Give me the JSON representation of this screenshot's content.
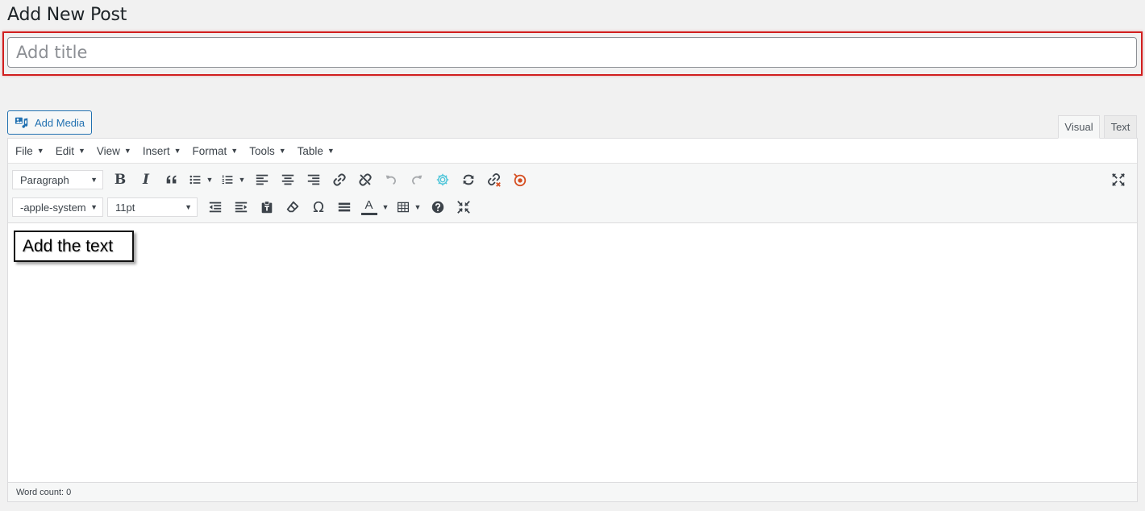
{
  "page": {
    "title": "Add New Post"
  },
  "title_field": {
    "placeholder": "Add title",
    "highlight_color": "#d11f1f"
  },
  "media": {
    "add_media_label": "Add Media"
  },
  "tabs": [
    {
      "label": "Visual",
      "active": true
    },
    {
      "label": "Text",
      "active": false
    }
  ],
  "menubar": {
    "items": [
      "File",
      "Edit",
      "View",
      "Insert",
      "Format",
      "Tools",
      "Table"
    ]
  },
  "toolbar": {
    "block_format": "Paragraph",
    "font_family": "-apple-system",
    "font_size": "11pt",
    "row1_icons": [
      "bold-icon",
      "italic-icon",
      "blockquote-icon",
      "bullet-list-icon",
      "numbered-list-icon",
      "align-left-icon",
      "align-center-icon",
      "align-right-icon",
      "link-icon",
      "unlink-icon",
      "undo-icon",
      "redo-icon",
      "gear-icon",
      "refresh-icon",
      "link-check-icon",
      "target-icon",
      "fullscreen-icon"
    ],
    "row2_icons": [
      "outdent-icon",
      "indent-icon",
      "paste-as-text-icon",
      "clear-formatting-icon",
      "special-character-icon",
      "horizontal-line-icon",
      "text-color-icon",
      "table-icon",
      "help-icon",
      "distraction-free-icon"
    ],
    "bold_label": "B",
    "italic_label": "I",
    "omega_label": "Ω",
    "text_color_label": "A",
    "accent": "#2271b1",
    "teal_icon_color": "#4ec5d9",
    "red_icon_color": "#d54e21"
  },
  "content": {
    "annotation": "Add the text"
  },
  "status": {
    "word_count": "Word count: 0"
  }
}
